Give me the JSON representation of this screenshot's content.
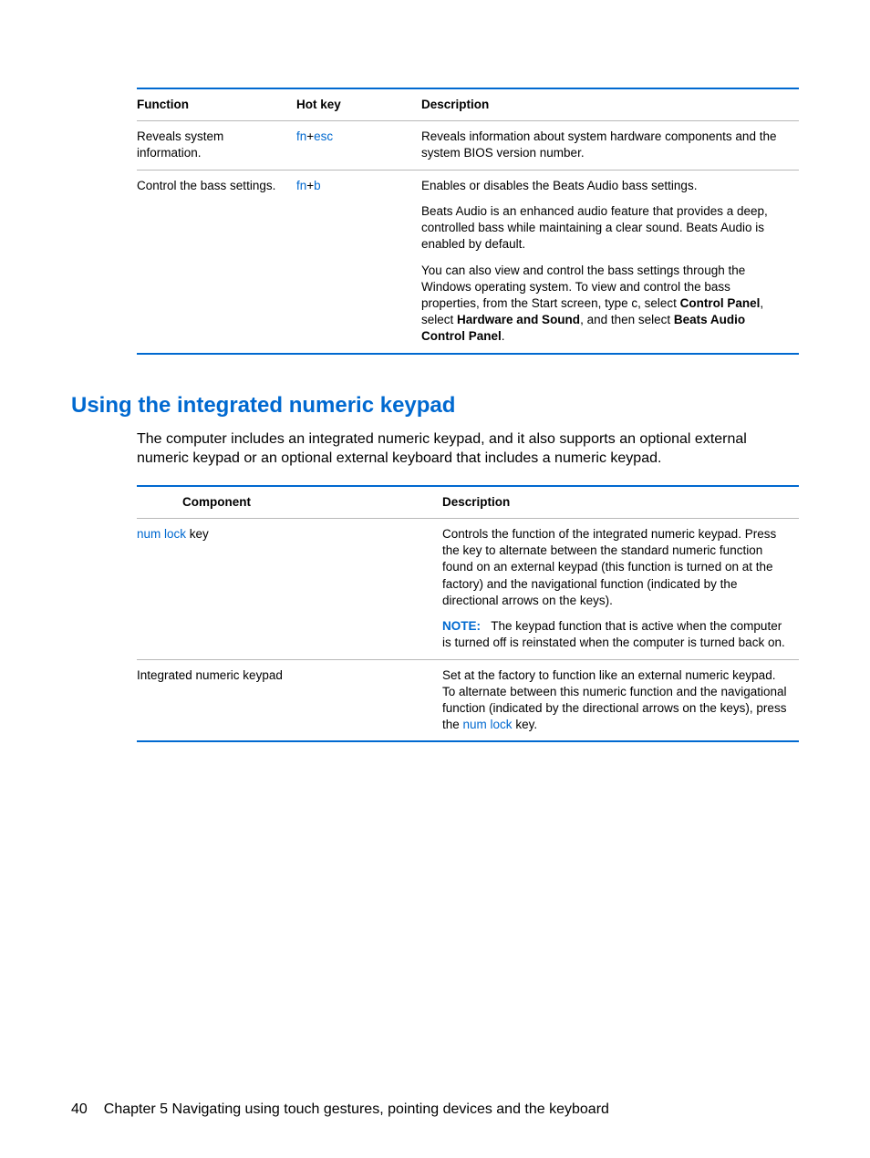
{
  "table1": {
    "headers": {
      "function": "Function",
      "hotkey": "Hot key",
      "description": "Description"
    },
    "rows": [
      {
        "function": "Reveals system information.",
        "hotkey_prefix": "fn",
        "hotkey_sep": "+",
        "hotkey_key": "esc",
        "desc_p1": "Reveals information about system hardware components and the system BIOS version number."
      },
      {
        "function": "Control the bass settings.",
        "hotkey_prefix": "fn",
        "hotkey_sep": "+",
        "hotkey_key": "b",
        "desc_p1": "Enables or disables the Beats Audio bass settings.",
        "desc_p2": "Beats Audio is an enhanced audio feature that provides a deep, controlled bass while maintaining a clear sound. Beats Audio is enabled by default.",
        "desc_p3_a": "You can also view and control the bass settings through the Windows operating system. To view and control the bass properties, from the Start screen, type ",
        "desc_p3_char": "c",
        "desc_p3_b": ", select ",
        "desc_p3_cp": "Control Panel",
        "desc_p3_c": ", select ",
        "desc_p3_hw": "Hardware and Sound",
        "desc_p3_d": ", and then select ",
        "desc_p3_bap": "Beats Audio Control Panel",
        "desc_p3_e": "."
      }
    ]
  },
  "section2": {
    "heading": "Using the integrated numeric keypad",
    "intro": "The computer includes an integrated numeric keypad, and it also supports an optional external numeric keypad or an optional external keyboard that includes a numeric keypad."
  },
  "table2": {
    "headers": {
      "component": "Component",
      "description": "Description"
    },
    "rows": [
      {
        "component_term": "num lock",
        "component_rest": " key",
        "desc_p1": "Controls the function of the integrated numeric keypad. Press the key to alternate between the standard numeric function found on an external keypad (this function is turned on at the factory) and the navigational function (indicated by the directional arrows on the keys).",
        "note_label": "NOTE:",
        "note_text": "The keypad function that is active when the computer is turned off is reinstated when the computer is turned back on."
      },
      {
        "component_plain": "Integrated numeric keypad",
        "desc_a": "Set at the factory to function like an external numeric keypad. To alternate between this numeric function and the navigational function (indicated by the directional arrows on the keys), press the ",
        "desc_term": "num lock",
        "desc_b": " key."
      }
    ]
  },
  "footer": {
    "page": "40",
    "chapter": "Chapter 5   Navigating using touch gestures, pointing devices and the keyboard"
  }
}
